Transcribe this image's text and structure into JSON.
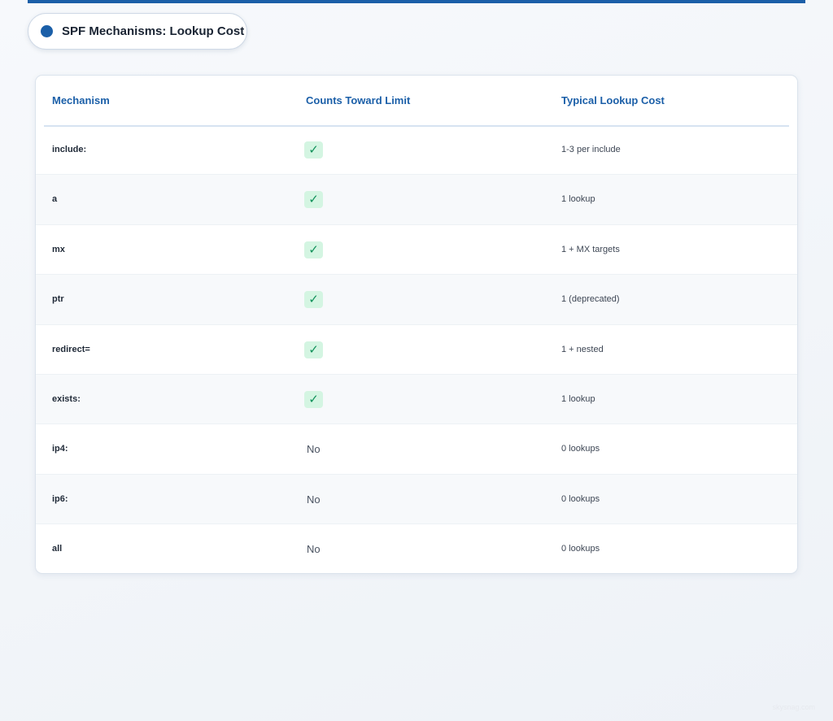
{
  "header": {
    "title": "SPF Mechanisms: Lookup Cost",
    "accent_color": "#1b5fa8"
  },
  "table": {
    "columns": [
      "Mechanism",
      "Counts Toward Limit",
      "Typical Lookup Cost"
    ],
    "rows": [
      {
        "mechanism": "include:",
        "counts": true,
        "counts_text": "✓",
        "cost": "1-3 per include"
      },
      {
        "mechanism": "a",
        "counts": true,
        "counts_text": "✓",
        "cost": "1 lookup"
      },
      {
        "mechanism": "mx",
        "counts": true,
        "counts_text": "✓",
        "cost": "1 + MX targets"
      },
      {
        "mechanism": "ptr",
        "counts": true,
        "counts_text": "✓",
        "cost": "1 (deprecated)"
      },
      {
        "mechanism": "redirect=",
        "counts": true,
        "counts_text": "✓",
        "cost": "1 + nested"
      },
      {
        "mechanism": "exists:",
        "counts": true,
        "counts_text": "✓",
        "cost": "1 lookup"
      },
      {
        "mechanism": "ip4:",
        "counts": false,
        "counts_text": "No",
        "cost": "0 lookups"
      },
      {
        "mechanism": "ip6:",
        "counts": false,
        "counts_text": "No",
        "cost": "0 lookups"
      },
      {
        "mechanism": "all",
        "counts": false,
        "counts_text": "No",
        "cost": "0 lookups"
      }
    ]
  },
  "footer": {
    "watermark": "skysnag.com"
  }
}
